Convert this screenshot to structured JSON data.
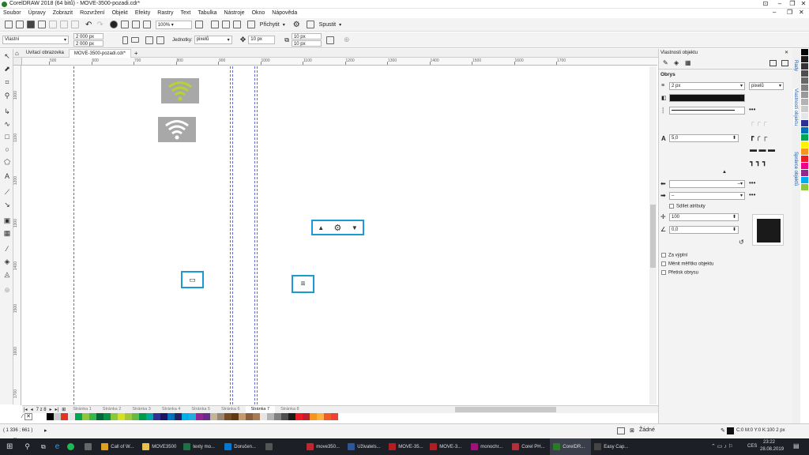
{
  "window": {
    "title": "CorelDRAW 2018 (64 bitů) - MOVE-3500-pozadi.cdr*"
  },
  "menu": [
    "Soubor",
    "Úpravy",
    "Zobrazit",
    "Rozvržení",
    "Objekt",
    "Efekty",
    "Rastry",
    "Text",
    "Tabulka",
    "Nástroje",
    "Okno",
    "Nápověda"
  ],
  "toolbar1": {
    "zoom": "100%",
    "snap_label": "Přichytit",
    "launch_label": "Spustit"
  },
  "propbar": {
    "preset": "Vlastní",
    "width": "2 000 px",
    "height": "2 000 px",
    "units_label": "Jednotky:",
    "units_value": "pixelů",
    "nudge": "10 px",
    "dup_x": "10 px",
    "dup_y": "10 px"
  },
  "doc_tabs": [
    "Uvítací obrazovka",
    "MOVE-3500-pozadi.cdr*"
  ],
  "hruler_labels": [
    "500",
    "600",
    "700",
    "800",
    "900",
    "1000",
    "1100",
    "1200",
    "1300",
    "1400",
    "1500",
    "1600",
    "1700"
  ],
  "vruler_labels": [
    "1000",
    "1100",
    "1200",
    "1300",
    "1400",
    "1500",
    "1600",
    "1700",
    "1800"
  ],
  "pages": {
    "nav": "7 z 8",
    "tabs": [
      "Stránka 1",
      "Stránka 2",
      "Stránka 3",
      "Stránka 4",
      "Stránka 5",
      "Stránka 6",
      "Stránka 7",
      "Stránka 8"
    ],
    "active": 6
  },
  "palette_colors": [
    "#ffffff",
    "#000000",
    "#c8c8c8",
    "#e53323",
    "#e6e6e6",
    "#00a651",
    "#8dc63f",
    "#39b54a",
    "#006838",
    "#009444",
    "#8cc63f",
    "#d7df23",
    "#a4c639",
    "#61bb46",
    "#009a49",
    "#00a99d",
    "#2e3192",
    "#1b1464",
    "#0072bc",
    "#262262",
    "#00aeef",
    "#27aae1",
    "#92278f",
    "#662d91",
    "#c2b59b",
    "#998675",
    "#754c24",
    "#603813",
    "#c49a6c",
    "#8b5e3c",
    "#a67c52",
    "#e6e6e6",
    "#b3b3b3",
    "#808080",
    "#4d4d4d",
    "#1a1a1a",
    "#ed1c24",
    "#be1e2d",
    "#f7941d",
    "#fbb040",
    "#f15a29",
    "#ef4136"
  ],
  "palette_right": [
    "#000000",
    "#1a1a1a",
    "#333333",
    "#4d4d4d",
    "#666666",
    "#808080",
    "#999999",
    "#b3b3b3",
    "#cccccc",
    "#e6e6e6",
    "#2e3192",
    "#0072bc",
    "#00a651",
    "#fff200",
    "#f7941d",
    "#ed1c24",
    "#ec008c",
    "#92278f",
    "#00aeef",
    "#8dc63f",
    "#ffffff"
  ],
  "status": {
    "coords": "( 1 336 ; 661 )",
    "fill_label": "Žádné",
    "outline_label": "C:0 M:0 Y:0 K:100  2 px"
  },
  "docker": {
    "title": "Vlastnosti objektu",
    "section": "Obrys",
    "outline_width": "2 px",
    "outline_units": "pixelů",
    "miter": "5,0",
    "combine_label": "Sdílet atributy",
    "scale_label": "100",
    "angle_label": "0,0",
    "behind_fill": "Za výplní",
    "scale_outline": "Měnit měřítko objektu",
    "overprint": "Přetisk obrysu",
    "side_tabs": [
      "Rady",
      "Vlastnosti objektu",
      "Správce objektů"
    ]
  },
  "taskbar": {
    "items": [
      {
        "label": "Call of W...",
        "color": "#e0a020"
      },
      {
        "label": "MOVE3500",
        "color": "#e8c050"
      },
      {
        "label": "texty mo...",
        "color": "#1e7145"
      },
      {
        "label": "Doručen...",
        "color": "#0078d4"
      },
      {
        "label": "",
        "color": "#555555"
      },
      {
        "label": "move350...",
        "color": "#c0282e"
      },
      {
        "label": "Uživatels...",
        "color": "#2b579a"
      },
      {
        "label": "MOVE-35...",
        "color": "#b01e23"
      },
      {
        "label": "MOVE-3...",
        "color": "#b01e23"
      },
      {
        "label": "monochr...",
        "color": "#a0107a"
      },
      {
        "label": "Corel PH...",
        "color": "#b0303a"
      },
      {
        "label": "CorelDR...",
        "color": "#2a7a2a"
      },
      {
        "label": "Easy Cap...",
        "color": "#444444"
      }
    ],
    "lang": "CES",
    "time": "23:22",
    "date": "28.08.2019"
  }
}
